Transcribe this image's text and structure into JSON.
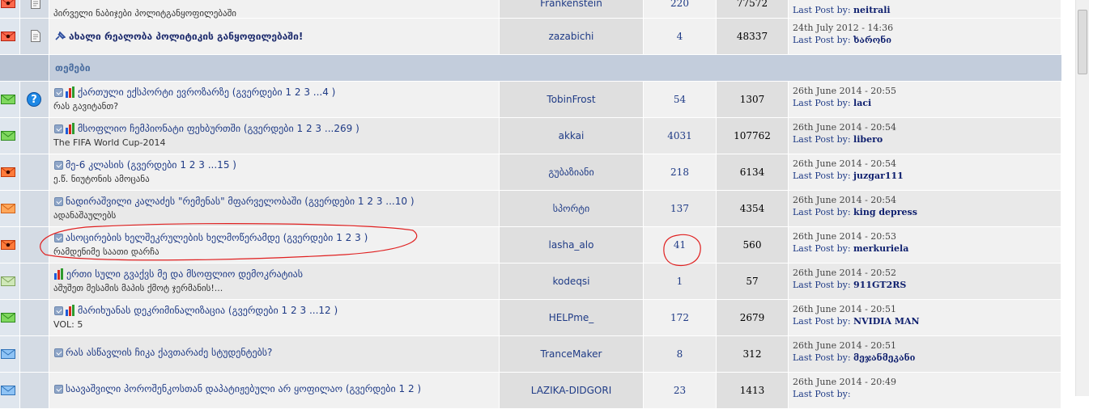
{
  "top_rows": [
    {
      "title": "",
      "subtitle": "პირველი ნაბიჯები პოლიტგანყოფილებაში",
      "author": "Frankenstein",
      "replies": "220",
      "views": "77572",
      "last_date": "",
      "last_by_label": "Last Post by:",
      "last_by": "neitrali",
      "status_icon": "envelope-red-icon"
    },
    {
      "title": "ახალი რეალობა პოლიტიკის განყოფილებაში!",
      "subtitle": "",
      "author": "zazabichi",
      "replies": "4",
      "views": "48337",
      "last_date": "24th July 2012 - 14:36",
      "last_by_label": "Last Post by:",
      "last_by": "ხარონი",
      "status_icon": "envelope-red-icon"
    }
  ],
  "category": {
    "title": "თემები"
  },
  "topics": [
    {
      "title": "ქართული ექსპორტი ევროზარზე",
      "pages_label": "(გვერდები",
      "pages": [
        "1",
        "2",
        "3",
        "...4"
      ],
      "has_poll": true,
      "has_question": true,
      "subtitle": "რას გავიტანთ?",
      "author": "TobinFrost",
      "replies": "54",
      "views": "1307",
      "last_date": "26th June 2014 - 20:55",
      "last_by": "laci",
      "status_icon": "envelope-green-icon"
    },
    {
      "title": "მსოფლიო ჩემპიონატი ფეხბურთში",
      "pages_label": "(გვერდები",
      "pages": [
        "1",
        "2",
        "3",
        "...269"
      ],
      "has_poll": true,
      "has_question": false,
      "subtitle": "The FIFA World Cup-2014",
      "author": "akkai",
      "replies": "4031",
      "views": "107762",
      "last_date": "26th June 2014 - 20:54",
      "last_by": "libero",
      "status_icon": "envelope-green-icon"
    },
    {
      "title": "მე-6 კლასის",
      "pages_label": "(გვერდები",
      "pages": [
        "1",
        "2",
        "3",
        "...15"
      ],
      "has_poll": false,
      "has_question": false,
      "subtitle": "ე.წ. ნიუტონის ამოცანა",
      "author": "გუბაზიანი",
      "replies": "218",
      "views": "6134",
      "last_date": "26th June 2014 - 20:54",
      "last_by": "juzgar111",
      "status_icon": "envelope-hot-icon"
    },
    {
      "title": "ნადირაშვილი კალაძეს \"რემენას\" მფარველობაში",
      "pages_label": "(გვერდები",
      "pages": [
        "1",
        "2",
        "3",
        "...10"
      ],
      "has_poll": false,
      "has_question": false,
      "subtitle": "ადანაშაულებს",
      "author": "სპორტი",
      "replies": "137",
      "views": "4354",
      "last_date": "26th June 2014 - 20:54",
      "last_by": "king depress",
      "status_icon": "envelope-orange-icon"
    },
    {
      "title": "ასოცირების ხელშეკრულების ხელმოწერამდე",
      "pages_label": "(გვერდები",
      "pages": [
        "1",
        "2",
        "3"
      ],
      "has_poll": false,
      "has_question": false,
      "subtitle": "რამდენიმე საათი დარჩა",
      "author": "lasha_alo",
      "replies": "41",
      "views": "560",
      "last_date": "26th June 2014 - 20:53",
      "last_by": "merkuriela",
      "status_icon": "envelope-hot-icon"
    },
    {
      "title": "ერთი სული გვაქვს მე და მსოფლიო დემოკრატიას",
      "pages_label": "",
      "pages": [],
      "has_poll": true,
      "has_question": false,
      "subtitle": "აშუშეთ მესამის მაპის ქმოტ ჯერმანის!...",
      "author": "kodeqsi",
      "replies": "1",
      "views": "57",
      "last_date": "26th June 2014 - 20:52",
      "last_by": "911GT2RS",
      "status_icon": "envelope-gray-icon"
    },
    {
      "title": "მარიხუანას დეკრიმინალიზაცია",
      "pages_label": "(გვერდები",
      "pages": [
        "1",
        "2",
        "3",
        "...12"
      ],
      "has_poll": true,
      "has_question": false,
      "subtitle": "VOL: 5",
      "author": "HELPme_",
      "replies": "172",
      "views": "2679",
      "last_date": "26th June 2014 - 20:51",
      "last_by": "NVIDIA MAN",
      "status_icon": "envelope-green-icon"
    },
    {
      "title": "რას ასწავლის ჩიკა ქავთარაძე სტუდენტებს?",
      "pages_label": "",
      "pages": [],
      "has_poll": false,
      "has_question": false,
      "subtitle": "",
      "author": "TranceMaker",
      "replies": "8",
      "views": "312",
      "last_date": "26th June 2014 - 20:51",
      "last_by": "მეჯანმეკანი",
      "status_icon": "envelope-blue-icon"
    },
    {
      "title": "საავაშვილი პოროშენკოსთან დაპატიჟებული არ ყოფილაო",
      "pages_label": "(გვერდები",
      "pages": [
        "1",
        "2"
      ],
      "has_poll": false,
      "has_question": false,
      "subtitle": "",
      "author": "LAZIKA-DIDGORI",
      "replies": "23",
      "views": "1413",
      "last_date": "26th June 2014 - 20:49",
      "last_by": "",
      "status_icon": "envelope-blue-icon"
    }
  ],
  "last_by_label": "Last Post by:",
  "colors": {
    "link": "#1f3b86",
    "category_bg": "#c3cddc",
    "category_text": "#4b6ea0",
    "annotation": "#e02020"
  }
}
